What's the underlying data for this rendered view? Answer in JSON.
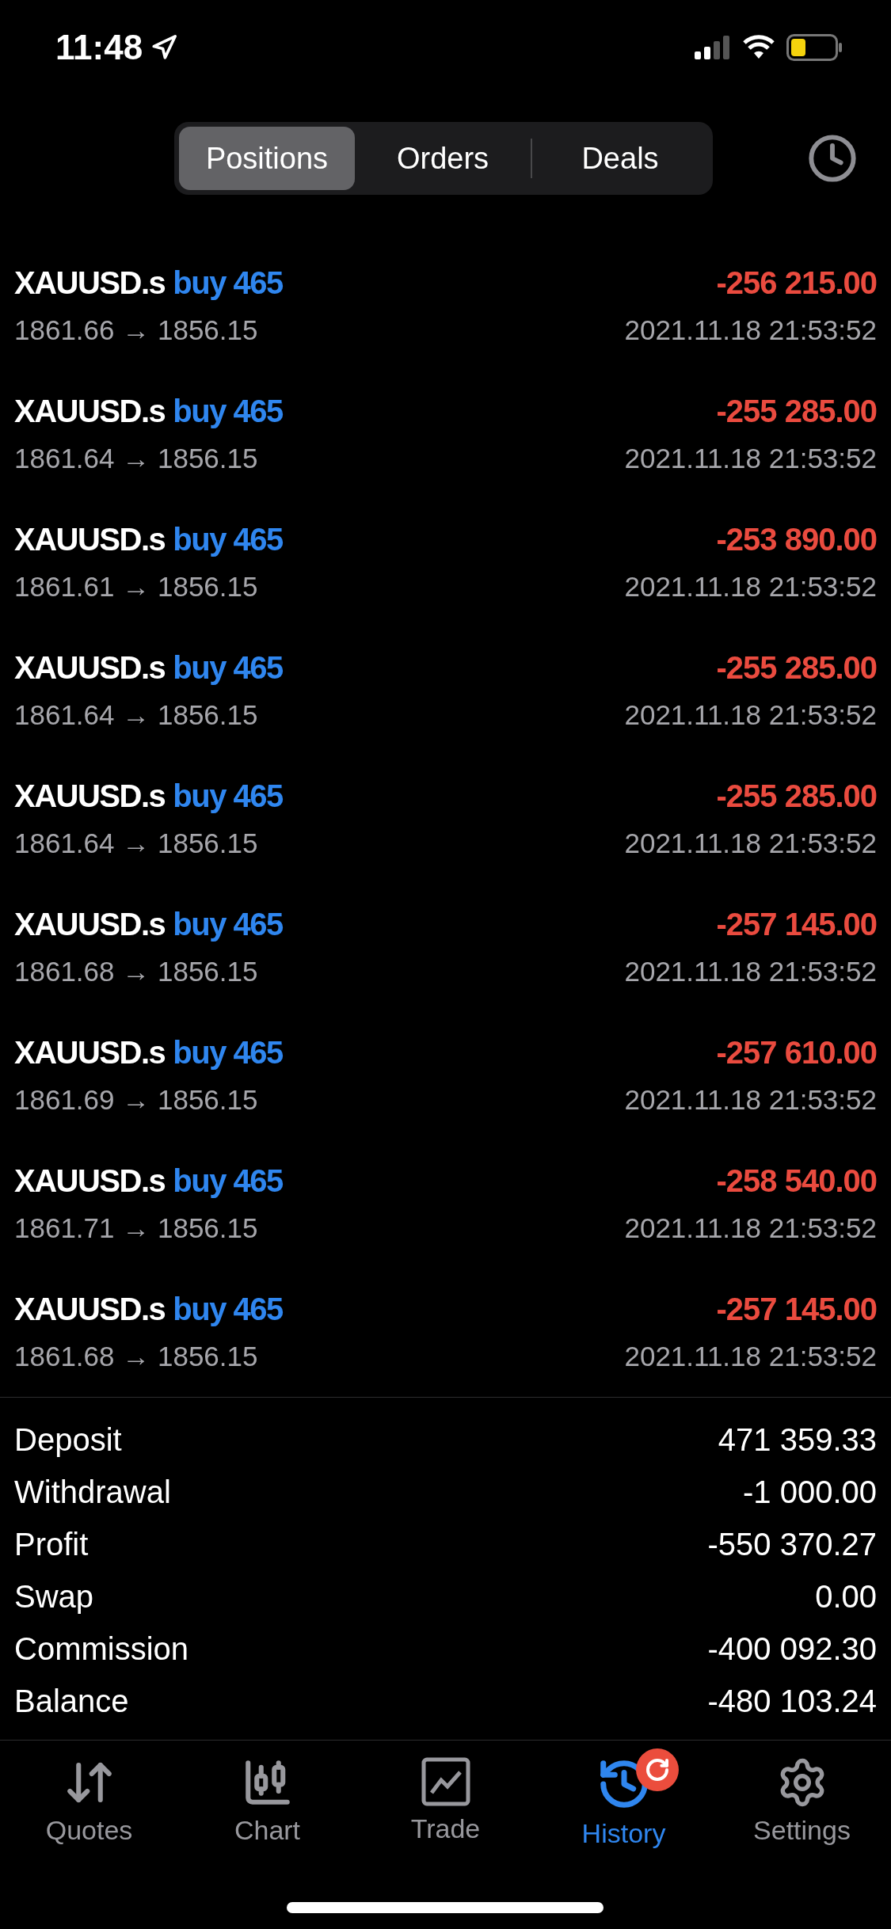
{
  "status_bar": {
    "time": "11:48"
  },
  "segments": [
    {
      "label": "Positions",
      "selected": true
    },
    {
      "label": "Orders",
      "selected": false
    },
    {
      "label": "Deals",
      "selected": false
    }
  ],
  "positions": [
    {
      "symbol": "XAUUSD.s",
      "order": "buy 465",
      "prices": "1861.66 → 1856.15",
      "profit": "-256 215.00",
      "time": "2021.11.18 21:53:52"
    },
    {
      "symbol": "XAUUSD.s",
      "order": "buy 465",
      "prices": "1861.64 → 1856.15",
      "profit": "-255 285.00",
      "time": "2021.11.18 21:53:52"
    },
    {
      "symbol": "XAUUSD.s",
      "order": "buy 465",
      "prices": "1861.61 → 1856.15",
      "profit": "-253 890.00",
      "time": "2021.11.18 21:53:52"
    },
    {
      "symbol": "XAUUSD.s",
      "order": "buy 465",
      "prices": "1861.64 → 1856.15",
      "profit": "-255 285.00",
      "time": "2021.11.18 21:53:52"
    },
    {
      "symbol": "XAUUSD.s",
      "order": "buy 465",
      "prices": "1861.64 → 1856.15",
      "profit": "-255 285.00",
      "time": "2021.11.18 21:53:52"
    },
    {
      "symbol": "XAUUSD.s",
      "order": "buy 465",
      "prices": "1861.68 → 1856.15",
      "profit": "-257 145.00",
      "time": "2021.11.18 21:53:52"
    },
    {
      "symbol": "XAUUSD.s",
      "order": "buy 465",
      "prices": "1861.69 → 1856.15",
      "profit": "-257 610.00",
      "time": "2021.11.18 21:53:52"
    },
    {
      "symbol": "XAUUSD.s",
      "order": "buy 465",
      "prices": "1861.71 → 1856.15",
      "profit": "-258 540.00",
      "time": "2021.11.18 21:53:52"
    },
    {
      "symbol": "XAUUSD.s",
      "order": "buy 465",
      "prices": "1861.68 → 1856.15",
      "profit": "-257 145.00",
      "time": "2021.11.18 21:53:52"
    }
  ],
  "summary": [
    {
      "label": "Deposit",
      "value": "471 359.33"
    },
    {
      "label": "Withdrawal",
      "value": "-1 000.00"
    },
    {
      "label": "Profit",
      "value": "-550 370.27"
    },
    {
      "label": "Swap",
      "value": "0.00"
    },
    {
      "label": "Commission",
      "value": "-400 092.30"
    },
    {
      "label": "Balance",
      "value": "-480 103.24"
    }
  ],
  "tab_bar": [
    {
      "label": "Quotes",
      "selected": false,
      "badge": false
    },
    {
      "label": "Chart",
      "selected": false,
      "badge": false
    },
    {
      "label": "Trade",
      "selected": false,
      "badge": false
    },
    {
      "label": "History",
      "selected": true,
      "badge": true
    },
    {
      "label": "Settings",
      "selected": false,
      "badge": false
    }
  ]
}
